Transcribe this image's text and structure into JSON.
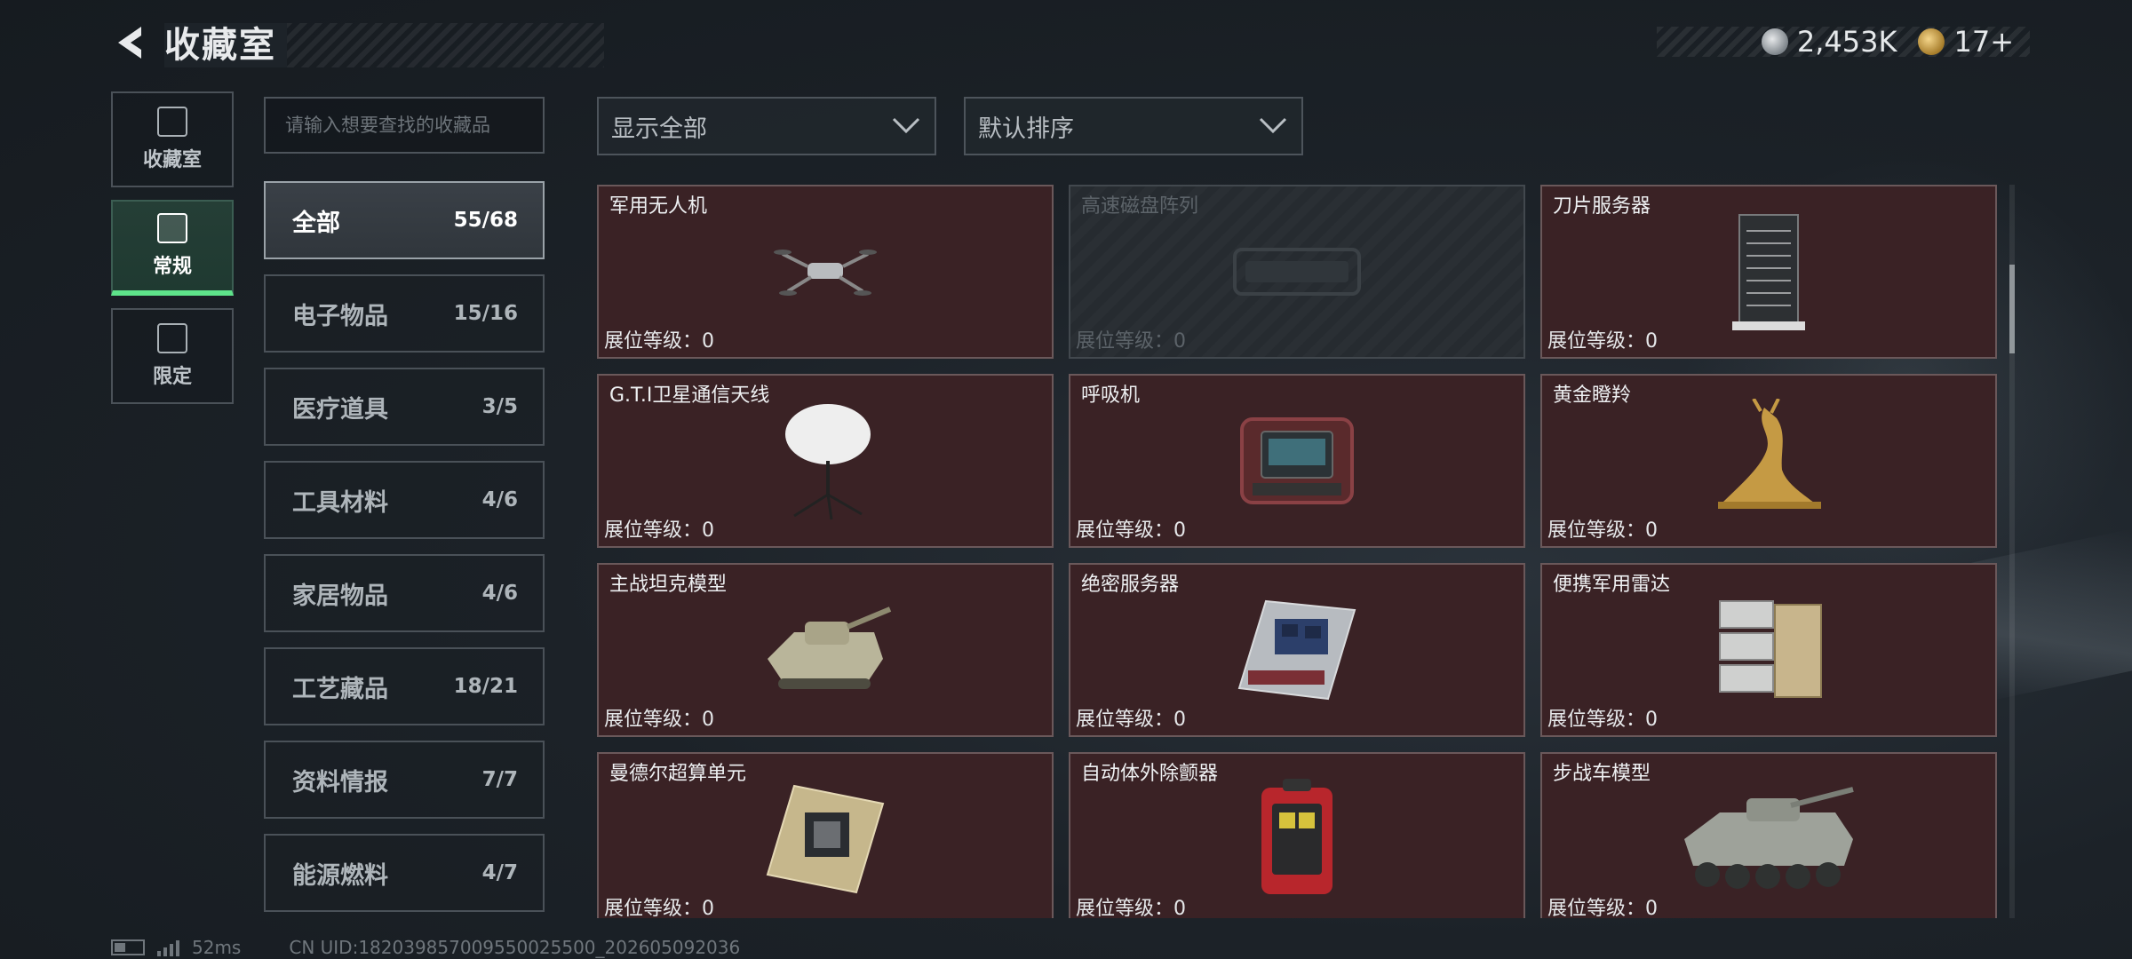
{
  "header": {
    "title": "收藏室",
    "currency": [
      {
        "icon": "silver-coin-icon",
        "value": "2,453K"
      },
      {
        "icon": "gold-token-icon",
        "value": "17+"
      }
    ]
  },
  "leftnav": {
    "items": [
      {
        "label": "收藏室",
        "icon": "vault-icon",
        "active": false
      },
      {
        "label": "常规",
        "icon": "regular-collection-icon",
        "active": true
      },
      {
        "label": "限定",
        "icon": "limited-collection-icon",
        "active": false
      }
    ]
  },
  "search": {
    "placeholder": "请输入想要查找的收藏品"
  },
  "categories": [
    {
      "name": "全部",
      "count": "55/68",
      "active": true
    },
    {
      "name": "电子物品",
      "count": "15/16",
      "active": false
    },
    {
      "name": "医疗道具",
      "count": "3/5",
      "active": false
    },
    {
      "name": "工具材料",
      "count": "4/6",
      "active": false
    },
    {
      "name": "家居物品",
      "count": "4/6",
      "active": false
    },
    {
      "name": "工艺藏品",
      "count": "18/21",
      "active": false
    },
    {
      "name": "资料情报",
      "count": "7/7",
      "active": false
    },
    {
      "name": "能源燃料",
      "count": "4/7",
      "active": false
    }
  ],
  "filters": {
    "show": "显示全部",
    "sort": "默认排序"
  },
  "level_label": "展位等级：",
  "items": [
    {
      "name": "军用无人机",
      "level": "0",
      "locked": false,
      "icon": "military-drone-icon"
    },
    {
      "name": "高速磁盘阵列",
      "level": "0",
      "locked": true,
      "icon": "disk-array-icon"
    },
    {
      "name": "刀片服务器",
      "level": "0",
      "locked": false,
      "icon": "blade-server-icon"
    },
    {
      "name": "G.T.I卫星通信天线",
      "level": "0",
      "locked": false,
      "icon": "satellite-antenna-icon"
    },
    {
      "name": "呼吸机",
      "level": "0",
      "locked": false,
      "icon": "ventilator-icon"
    },
    {
      "name": "黄金瞪羚",
      "level": "0",
      "locked": false,
      "icon": "golden-gazelle-icon"
    },
    {
      "name": "主战坦克模型",
      "level": "0",
      "locked": false,
      "icon": "tank-model-icon"
    },
    {
      "name": "绝密服务器",
      "level": "0",
      "locked": false,
      "icon": "secret-server-icon"
    },
    {
      "name": "便携军用雷达",
      "level": "0",
      "locked": false,
      "icon": "portable-radar-icon"
    },
    {
      "name": "曼德尔超算单元",
      "level": "0",
      "locked": false,
      "icon": "supercomputer-unit-icon"
    },
    {
      "name": "自动体外除颤器",
      "level": "0",
      "locked": false,
      "icon": "defibrillator-icon"
    },
    {
      "name": "步战车模型",
      "level": "0",
      "locked": false,
      "icon": "ifv-model-icon"
    }
  ],
  "footer": {
    "ping": "52ms",
    "uid": "CN UID:1820398570095500​25500_202605092036"
  }
}
